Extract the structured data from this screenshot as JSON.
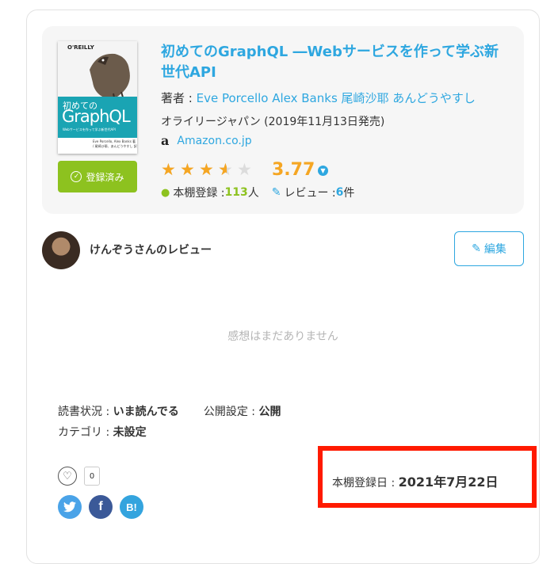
{
  "book": {
    "title": "初めてのGraphQL ―Webサービスを作って学ぶ新世代API",
    "author_prefix": "著者 : ",
    "authors": "Eve Porcello Alex Banks 尾崎沙耶 あんどうやすし",
    "publisher": "オライリージャパン (2019年11月13日発売)",
    "store_link": "Amazon.co.jp",
    "store_icon": "amazon-icon",
    "registered_label": "登録済み",
    "cover": {
      "publisher_mark": "O'REILLY",
      "title_jp": "初めての",
      "title_en": "GraphQL",
      "subtitle": "Webサービスを作って学ぶ新世代API",
      "authors": "Eve Porcello, Alex Banks 著 / 尾崎沙耶、あんどうやすし 訳"
    },
    "rating": {
      "value": "3.77",
      "stars_out_of": 5,
      "stars_filled": 3.5
    },
    "stats": {
      "shelf_label": "本棚登録 : ",
      "shelf_count": "113",
      "shelf_unit": "人",
      "review_label": "レビュー : ",
      "review_count": "6",
      "review_unit": "件"
    }
  },
  "review": {
    "reviewer": "けんぞうさんのレビュー",
    "edit_label": "編集",
    "empty_text": "感想はまだありません",
    "reading_status_label": "読書状況 : ",
    "reading_status_value": "いま読んでる",
    "visibility_label": "公開設定 : ",
    "visibility_value": "公開",
    "category_label": "カテゴリ : ",
    "category_value": "未設定",
    "like_count": "0",
    "registered_date_label": "本棚登録日 : ",
    "registered_date_value": "2021年7月22日"
  },
  "social": {
    "twitter": "t",
    "facebook": "f",
    "hatena": "B!"
  },
  "colors": {
    "accent_blue": "#2ea7e0",
    "accent_green": "#8dc21f",
    "star": "#f5a623",
    "highlight": "#ff1a00"
  }
}
